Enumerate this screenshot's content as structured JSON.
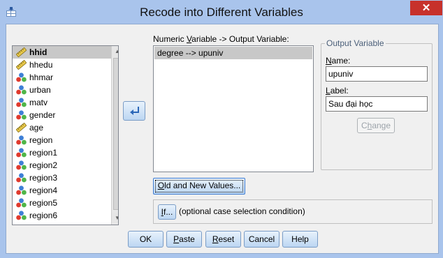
{
  "window": {
    "title": "Recode into Different Variables",
    "close_glyph": "✕"
  },
  "variables": [
    {
      "name": "hhid",
      "icon": "scale-ruler-icon",
      "selected": true
    },
    {
      "name": "hhedu",
      "icon": "scale-ruler-icon"
    },
    {
      "name": "hhmar",
      "icon": "nominal-balls-icon"
    },
    {
      "name": "urban",
      "icon": "nominal-balls-icon"
    },
    {
      "name": "matv",
      "icon": "nominal-balls-icon"
    },
    {
      "name": "gender",
      "icon": "nominal-balls-icon"
    },
    {
      "name": "age",
      "icon": "scale-ruler-icon"
    },
    {
      "name": "region",
      "icon": "nominal-balls-icon"
    },
    {
      "name": "region1",
      "icon": "nominal-balls-icon"
    },
    {
      "name": "region2",
      "icon": "nominal-balls-icon"
    },
    {
      "name": "region3",
      "icon": "nominal-balls-icon"
    },
    {
      "name": "region4",
      "icon": "nominal-balls-icon"
    },
    {
      "name": "region5",
      "icon": "nominal-balls-icon"
    },
    {
      "name": "region6",
      "icon": "nominal-balls-icon"
    }
  ],
  "numeric_var": {
    "label_pre": "Numeric ",
    "label_ul": "V",
    "label_post": "ariable -> Output Variable:",
    "items": [
      "degree --> upuniv"
    ]
  },
  "output_var": {
    "legend": "Output Variable",
    "name_ul": "N",
    "name_rest": "ame:",
    "name_value": "upuniv",
    "label_ul": "L",
    "label_rest": "abel:",
    "label_value": "Sau đại học",
    "change_pre": "C",
    "change_ul": "h",
    "change_post": "ange"
  },
  "old_new": {
    "ul": "O",
    "rest": "ld and New Values..."
  },
  "if_cond": {
    "button_ul": "I",
    "button_rest": "f...",
    "text": "(optional case selection condition)"
  },
  "buttons": {
    "ok": "OK",
    "paste_ul": "P",
    "paste_rest": "aste",
    "reset_ul": "R",
    "reset_rest": "eset",
    "cancel": "Cancel",
    "help": "Help"
  },
  "colors": {
    "title_bar": "#a9c4ec",
    "close": "#c7312b",
    "selection": "#c8c8c8"
  }
}
